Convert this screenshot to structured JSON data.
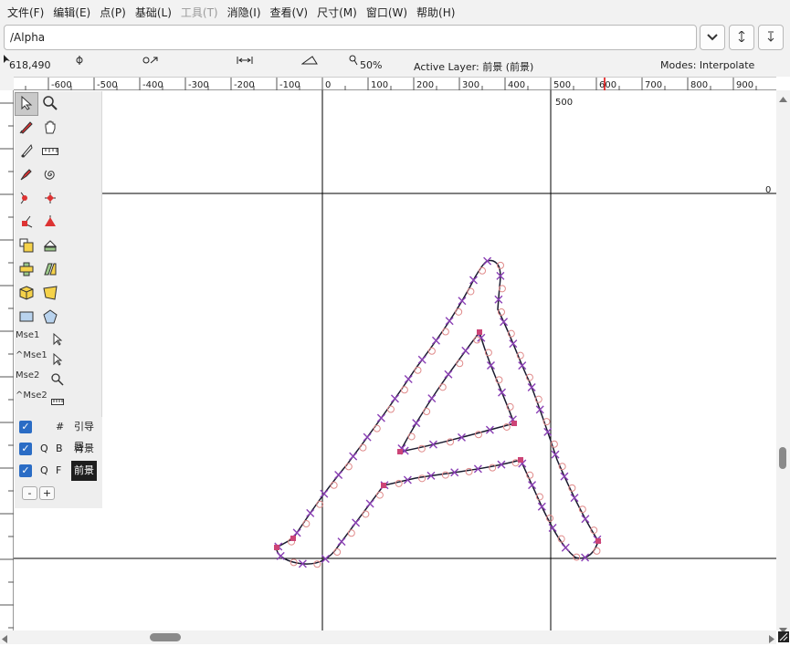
{
  "menu": [
    {
      "label": "文件(F)",
      "disabled": false
    },
    {
      "label": "编辑(E)",
      "disabled": false
    },
    {
      "label": "点(P)",
      "disabled": false
    },
    {
      "label": "基础(L)",
      "disabled": false
    },
    {
      "label": "工具(T)",
      "disabled": true
    },
    {
      "label": "消隐(I)",
      "disabled": false
    },
    {
      "label": "查看(V)",
      "disabled": false
    },
    {
      "label": "尺寸(M)",
      "disabled": false
    },
    {
      "label": "窗口(W)",
      "disabled": false
    },
    {
      "label": "帮助(H)",
      "disabled": false
    }
  ],
  "glyph": {
    "value": "/Alpha"
  },
  "info": {
    "coords": "618,490",
    "zoom": "50%",
    "active_layer": "Active Layer: 前景 (前景)",
    "modes": "Modes: Interpolate"
  },
  "ruler": {
    "h_labels": [
      "-600",
      "-500",
      "-400",
      "-300",
      "-200",
      "-100",
      "0",
      "100",
      "200",
      "300",
      "400",
      "500",
      "600",
      "700",
      "800",
      "900"
    ]
  },
  "canvas": {
    "guide_label_500": "500",
    "guide_label_0": "0"
  },
  "toolbox": {
    "mse1": "Mse1",
    "ctrl_mse1": "^Mse1",
    "mse2": "Mse2",
    "ctrl_mse2": "^Mse2"
  },
  "layers": [
    {
      "q": "",
      "t": "#",
      "name": "引导层",
      "selected": false
    },
    {
      "q": "Q",
      "t": "B",
      "name": "背景",
      "selected": false
    },
    {
      "q": "Q",
      "t": "F",
      "name": "前景",
      "selected": true
    }
  ],
  "layer_buttons": {
    "remove": "-",
    "add": "+"
  },
  "colors": {
    "outline": "#1a1a2e",
    "point_x": "#8a3fb5",
    "control_circle": "#e08a8a",
    "point_square": "#cc4477"
  }
}
